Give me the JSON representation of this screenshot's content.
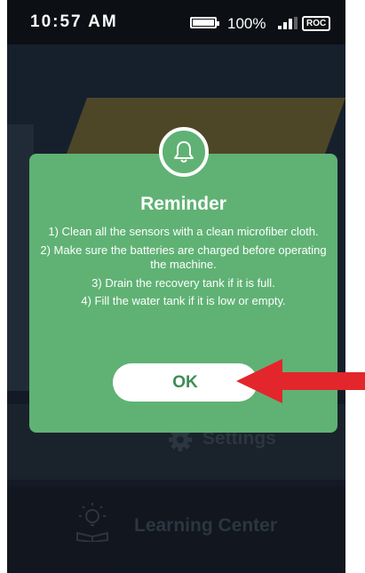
{
  "status_bar": {
    "time": "10:57 AM",
    "battery_percent": "100%",
    "signal_bars": 3,
    "carrier_badge": "ROC"
  },
  "background_menu": {
    "settings_label": "Settings",
    "learning_center_label": "Learning Center"
  },
  "dialog": {
    "icon": "bell-icon",
    "title": "Reminder",
    "items": [
      "1) Clean all the sensors with a clean microfiber cloth.",
      "2) Make sure the batteries are charged before operating the machine.",
      "3) Drain the recovery tank if it is full.",
      "4) Fill the water tank if it is low or empty."
    ],
    "ok_label": "OK"
  },
  "annotation": {
    "arrow_icon": "red-arrow-icon",
    "arrow_color": "#e3262b"
  },
  "colors": {
    "dialog_green": "#5fb274",
    "ok_text_green": "#3f8c52",
    "status_bar": "#0c0f14",
    "app_background": "#18202c"
  }
}
